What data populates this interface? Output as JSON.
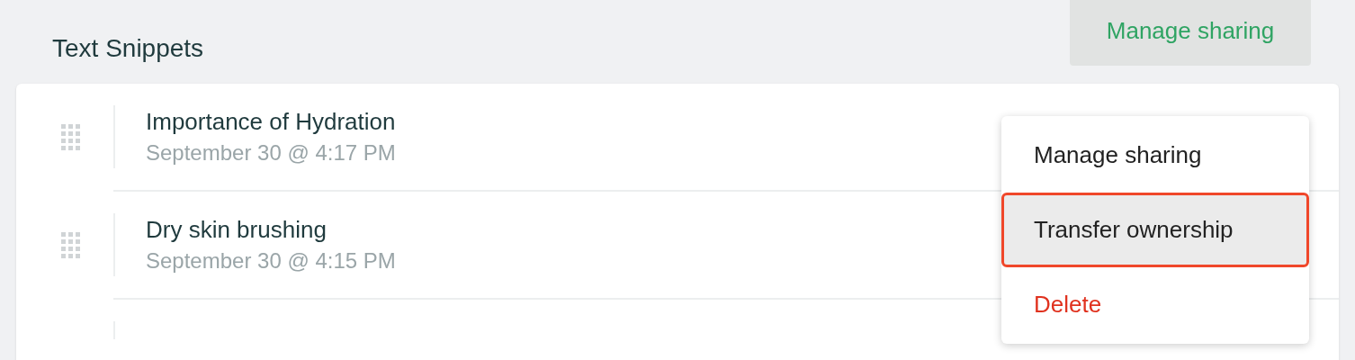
{
  "header": {
    "title": "Text Snippets",
    "button": "Manage sharing"
  },
  "snippets": [
    {
      "title": "Importance of Hydration",
      "date": "September 30 @ 4:17 PM"
    },
    {
      "title": "Dry skin brushing",
      "date": "September 30 @ 4:15 PM"
    }
  ],
  "menu": [
    {
      "label": "Manage sharing",
      "kind": "normal",
      "selected": false
    },
    {
      "label": "Transfer ownership",
      "kind": "normal",
      "selected": true
    },
    {
      "label": "Delete",
      "kind": "danger",
      "selected": false
    }
  ]
}
